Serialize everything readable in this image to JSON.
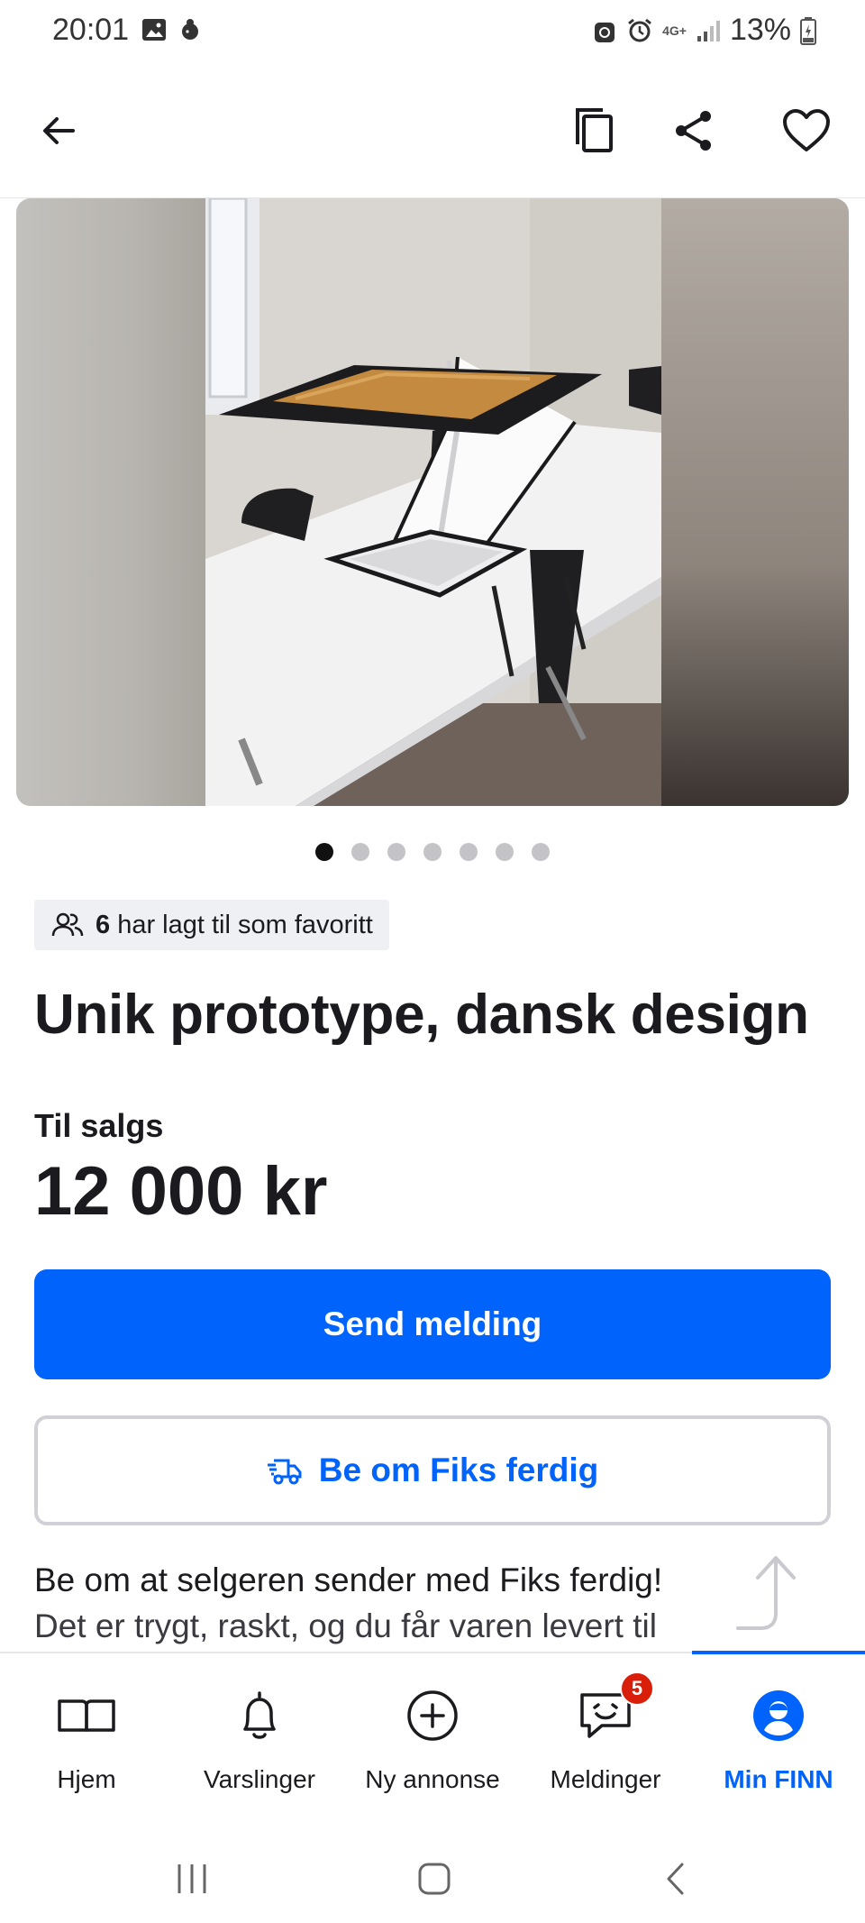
{
  "status_bar": {
    "time": "20:01",
    "network": "4G+",
    "battery": "13%",
    "icons": [
      "image-icon",
      "app-icon",
      "sync-icon",
      "alarm-icon",
      "signal-icon",
      "battery-icon"
    ]
  },
  "app_bar": {
    "icons": [
      "back-arrow-icon",
      "copy-icon",
      "share-icon",
      "heart-icon"
    ]
  },
  "gallery": {
    "image_count": 7,
    "current_index": 1
  },
  "listing": {
    "favorites_count": "6",
    "favorites_text": "har lagt til som favoritt",
    "title": "Unik prototype, dansk design",
    "sale_type": "Til salgs",
    "price": "12 000 kr"
  },
  "actions": {
    "send_message": "Send melding",
    "fiks_ferdig": "Be om Fiks ferdig"
  },
  "promo": {
    "title": "Be om at selgeren sender med Fiks ferdig!",
    "body": "Det er trygt, raskt, og du får varen levert til"
  },
  "bottom_nav": {
    "items": [
      {
        "label": "Hjem",
        "icon": "book-icon"
      },
      {
        "label": "Varslinger",
        "icon": "bell-icon"
      },
      {
        "label": "Ny annonse",
        "icon": "plus-circle-icon"
      },
      {
        "label": "Meldinger",
        "icon": "chat-icon",
        "badge": "5"
      },
      {
        "label": "Min FINN",
        "icon": "profile-icon",
        "active": true
      }
    ]
  },
  "colors": {
    "primary": "#0063fb",
    "badge": "#d91f0a",
    "text": "#1b1b1f"
  }
}
